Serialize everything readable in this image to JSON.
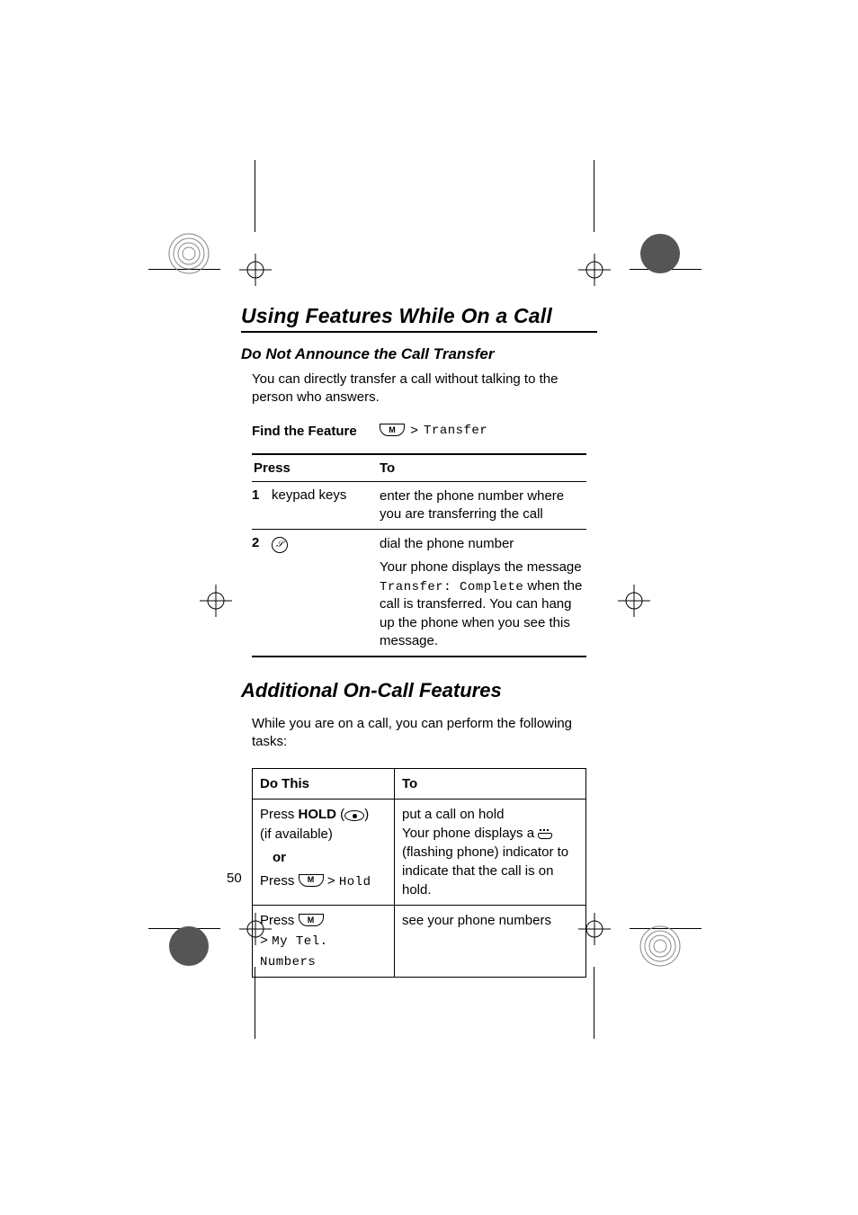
{
  "page_number": "50",
  "chapter_title": "Using Features While On a Call",
  "subsection_title": "Do Not Announce the Call Transfer",
  "intro_text": "You can directly transfer a call without talking to the person who answers.",
  "find_feature": {
    "label": "Find the Feature",
    "menu_key": "M",
    "path": "Transfer"
  },
  "steps": {
    "press_header": "Press",
    "to_header": "To",
    "rows": [
      {
        "num": "1",
        "press": "keypad keys",
        "to": "enter the phone number where you are transferring the call"
      },
      {
        "num": "2",
        "press_icon": "send-key",
        "to_line1": "dial the phone number",
        "to_line2_pre": "Your phone displays the message ",
        "to_line2_mono": "Transfer: Complete",
        "to_line2_post": " when the call is transferred. You can hang up the phone when you see this message."
      }
    ]
  },
  "section2_title": "Additional On-Call Features",
  "section2_intro": "While you are on a call, you can perform the following tasks:",
  "oncall": {
    "h1": "Do This",
    "h2": "To",
    "rows": [
      {
        "press_label": "Press ",
        "hold_label": "HOLD",
        "if_avail": "(if available)",
        "or": "or",
        "press2": "Press ",
        "hold_mono": "Hold",
        "to_line1": "put a call on hold",
        "to_line2_pre": "Your phone displays a ",
        "to_line2_post": " (flashing phone) indicator to indicate that the call is on hold."
      },
      {
        "press": "Press ",
        "path": "My Tel. Numbers",
        "to": "see your phone numbers"
      }
    ]
  }
}
